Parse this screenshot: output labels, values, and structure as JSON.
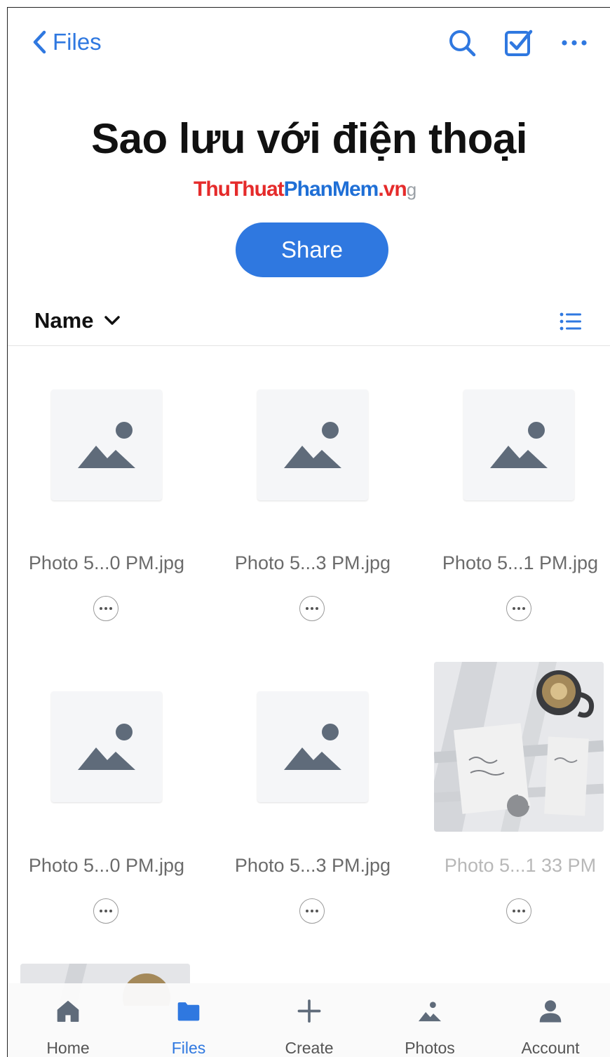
{
  "nav": {
    "back_label": "Files"
  },
  "folder": {
    "title": "Sao lưu với điện thoại",
    "watermark_part1": "ThuThuat",
    "watermark_part2": "PhanMem",
    "watermark_part3": ".vn",
    "watermark_tail": "g"
  },
  "actions": {
    "share_label": "Share"
  },
  "sort": {
    "label": "Name"
  },
  "files": [
    {
      "name": "Photo 5...0 PM.jpg",
      "thumbnail": "placeholder"
    },
    {
      "name": "Photo 5...3 PM.jpg",
      "thumbnail": "placeholder"
    },
    {
      "name": "Photo 5...1 PM.jpg",
      "thumbnail": "placeholder"
    },
    {
      "name": "Photo 5...0 PM.jpg",
      "thumbnail": "placeholder"
    },
    {
      "name": "Photo 5...3 PM.jpg",
      "thumbnail": "placeholder"
    },
    {
      "name": "Photo 5...1 33 PM",
      "thumbnail": "photo",
      "uploading": true
    }
  ],
  "tabs": [
    {
      "label": "Home",
      "icon": "home-icon"
    },
    {
      "label": "Files",
      "icon": "folder-icon",
      "active": true
    },
    {
      "label": "Create",
      "icon": "plus-icon"
    },
    {
      "label": "Photos",
      "icon": "photos-icon"
    },
    {
      "label": "Account",
      "icon": "person-icon"
    }
  ],
  "colors": {
    "accent": "#2f78e0",
    "icon_gray": "#5f6b7a",
    "text_gray": "#6b6b6b"
  }
}
